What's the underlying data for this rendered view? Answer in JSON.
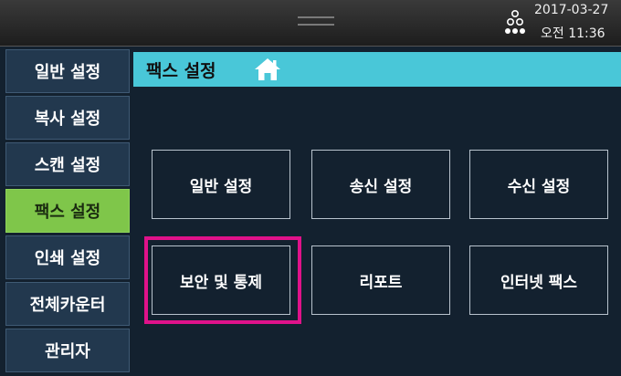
{
  "status": {
    "date": "2017-03-27",
    "time": "오전 11:36",
    "icon": "network-status-icon"
  },
  "sidebar": {
    "items": [
      {
        "label": "일반 설정",
        "active": false
      },
      {
        "label": "복사 설정",
        "active": false
      },
      {
        "label": "스캔 설정",
        "active": false
      },
      {
        "label": "팩스 설정",
        "active": true
      },
      {
        "label": "인쇄 설정",
        "active": false
      },
      {
        "label": "전체카운터",
        "active": false
      },
      {
        "label": "관리자",
        "active": false
      }
    ]
  },
  "main": {
    "title": "팩스 설정",
    "home_icon": "home-icon",
    "tiles": [
      {
        "label": "일반 설정"
      },
      {
        "label": "송신 설정"
      },
      {
        "label": "수신 설정"
      },
      {
        "label": "보안 및 통제",
        "highlighted": true
      },
      {
        "label": "리포트"
      },
      {
        "label": "인터넷 팩스"
      }
    ]
  },
  "colors": {
    "title_bar": "#49c7d8",
    "active_menu": "#7fc64a",
    "highlight": "#e0128a",
    "background": "#13212f"
  }
}
